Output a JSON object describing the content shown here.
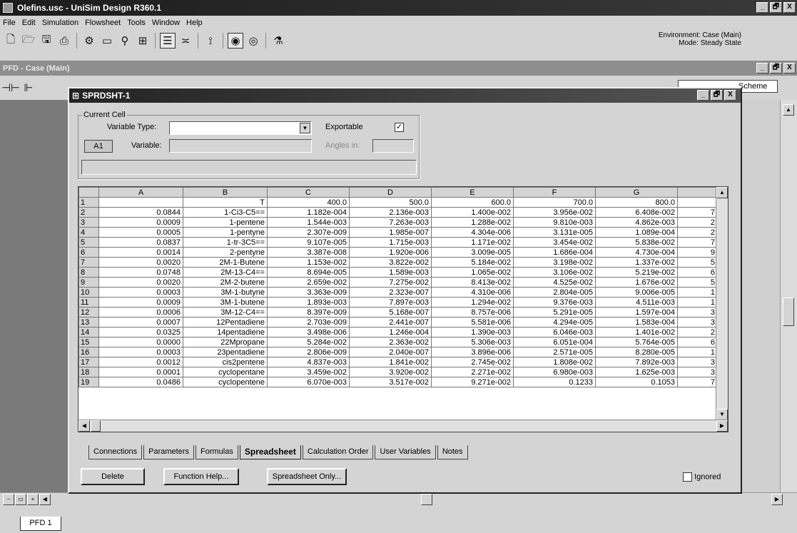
{
  "app": {
    "title": "Olefins.usc - UniSim Design R360.1"
  },
  "window_buttons": [
    "_",
    "🗗",
    "X"
  ],
  "menu": [
    "File",
    "Edit",
    "Simulation",
    "Flowsheet",
    "Tools",
    "Window",
    "Help"
  ],
  "environment": {
    "line1": "Environment: Case (Main)",
    "line2": "Mode: Steady State"
  },
  "pfd": {
    "title": "PFD - Case (Main)",
    "scheme_label": "Scheme",
    "tab": "PFD 1"
  },
  "spreadsheet": {
    "title": "SPRDSHT-1",
    "current_cell": {
      "group_label": "Current Cell",
      "variable_type_label": "Variable Type:",
      "variable_type_value": "",
      "exportable_label": "Exportable",
      "exportable_checked": "✓",
      "cell_ref": "A1",
      "variable_label": "Variable:",
      "variable_value": "",
      "angles_label": "Angles in:",
      "angles_value": "",
      "formula_value": ""
    },
    "columns": [
      "A",
      "B",
      "C",
      "D",
      "E",
      "F",
      "G",
      ""
    ],
    "rows": [
      [
        "1",
        "",
        "T",
        "400.0",
        "500.0",
        "600.0",
        "700.0",
        "800.0",
        ""
      ],
      [
        "2",
        "0.0844",
        "1-Ci3-C5==",
        "1.182e-004",
        "2.136e-003",
        "1.400e-002",
        "3.956e-002",
        "6.408e-002",
        "7"
      ],
      [
        "3",
        "0.0009",
        "1-pentene",
        "1.544e-003",
        "7.263e-003",
        "1.288e-002",
        "9.810e-003",
        "4.862e-003",
        "2"
      ],
      [
        "4",
        "0.0005",
        "1-pentyne",
        "2.307e-009",
        "1.985e-007",
        "4.304e-006",
        "3.131e-005",
        "1.089e-004",
        "2"
      ],
      [
        "5",
        "0.0837",
        "1-tr-3C5==",
        "9.107e-005",
        "1.715e-003",
        "1.171e-002",
        "3.454e-002",
        "5.838e-002",
        "7"
      ],
      [
        "6",
        "0.0014",
        "2-pentyne",
        "3.387e-008",
        "1.920e-006",
        "3.009e-005",
        "1.686e-004",
        "4.730e-004",
        "9"
      ],
      [
        "7",
        "0.0020",
        "2M-1-Butene",
        "1.153e-002",
        "3.822e-002",
        "5.184e-002",
        "3.198e-002",
        "1.337e-002",
        "5"
      ],
      [
        "8",
        "0.0748",
        "2M-13-C4==",
        "8.694e-005",
        "1.589e-003",
        "1.065e-002",
        "3.106e-002",
        "5.219e-002",
        "6"
      ],
      [
        "9",
        "0.0020",
        "2M-2-butene",
        "2.659e-002",
        "7.275e-002",
        "8.413e-002",
        "4.525e-002",
        "1.676e-002",
        "5"
      ],
      [
        "10",
        "0.0003",
        "3M-1-butyne",
        "3.363e-009",
        "2.323e-007",
        "4.310e-006",
        "2.804e-005",
        "9.006e-005",
        "1"
      ],
      [
        "11",
        "0.0009",
        "3M-1-butene",
        "1.893e-003",
        "7.897e-003",
        "1.294e-002",
        "9.376e-003",
        "4.511e-003",
        "1"
      ],
      [
        "12",
        "0.0006",
        "3M-12-C4==",
        "8.397e-009",
        "5.168e-007",
        "8.757e-006",
        "5.291e-005",
        "1.597e-004",
        "3"
      ],
      [
        "13",
        "0.0007",
        "12Pentadiene",
        "2.703e-009",
        "2.441e-007",
        "5.581e-006",
        "4.294e-005",
        "1.583e-004",
        "3"
      ],
      [
        "14",
        "0.0325",
        "14pentadiene",
        "3.498e-006",
        "1.246e-004",
        "1.390e-003",
        "6.046e-003",
        "1.401e-002",
        "2"
      ],
      [
        "15",
        "0.0000",
        "22Mpropane",
        "5.284e-002",
        "2.363e-002",
        "5.306e-003",
        "6.051e-004",
        "5.764e-005",
        "6"
      ],
      [
        "16",
        "0.0003",
        "23pentadiene",
        "2.806e-009",
        "2.040e-007",
        "3.896e-006",
        "2.571e-005",
        "8.280e-005",
        "1"
      ],
      [
        "17",
        "0.0012",
        "cis2pentene",
        "4.837e-003",
        "1.841e-002",
        "2.745e-002",
        "1.808e-002",
        "7.892e-003",
        "3"
      ],
      [
        "18",
        "0.0001",
        "cyclopentane",
        "3.459e-002",
        "3.920e-002",
        "2.271e-002",
        "6.980e-003",
        "1.625e-003",
        "3"
      ],
      [
        "19",
        "0.0486",
        "cyclopentene",
        "6.070e-003",
        "3.517e-002",
        "9.271e-002",
        "0.1233",
        "0.1053",
        "7"
      ]
    ],
    "tabs": [
      "Connections",
      "Parameters",
      "Formulas",
      "Spreadsheet",
      "Calculation Order",
      "User Variables",
      "Notes"
    ],
    "active_tab": "Spreadsheet",
    "buttons": {
      "delete": "Delete",
      "function_help": "Function Help...",
      "spreadsheet_only": "Spreadsheet Only..."
    },
    "ignored_label": "Ignored"
  }
}
